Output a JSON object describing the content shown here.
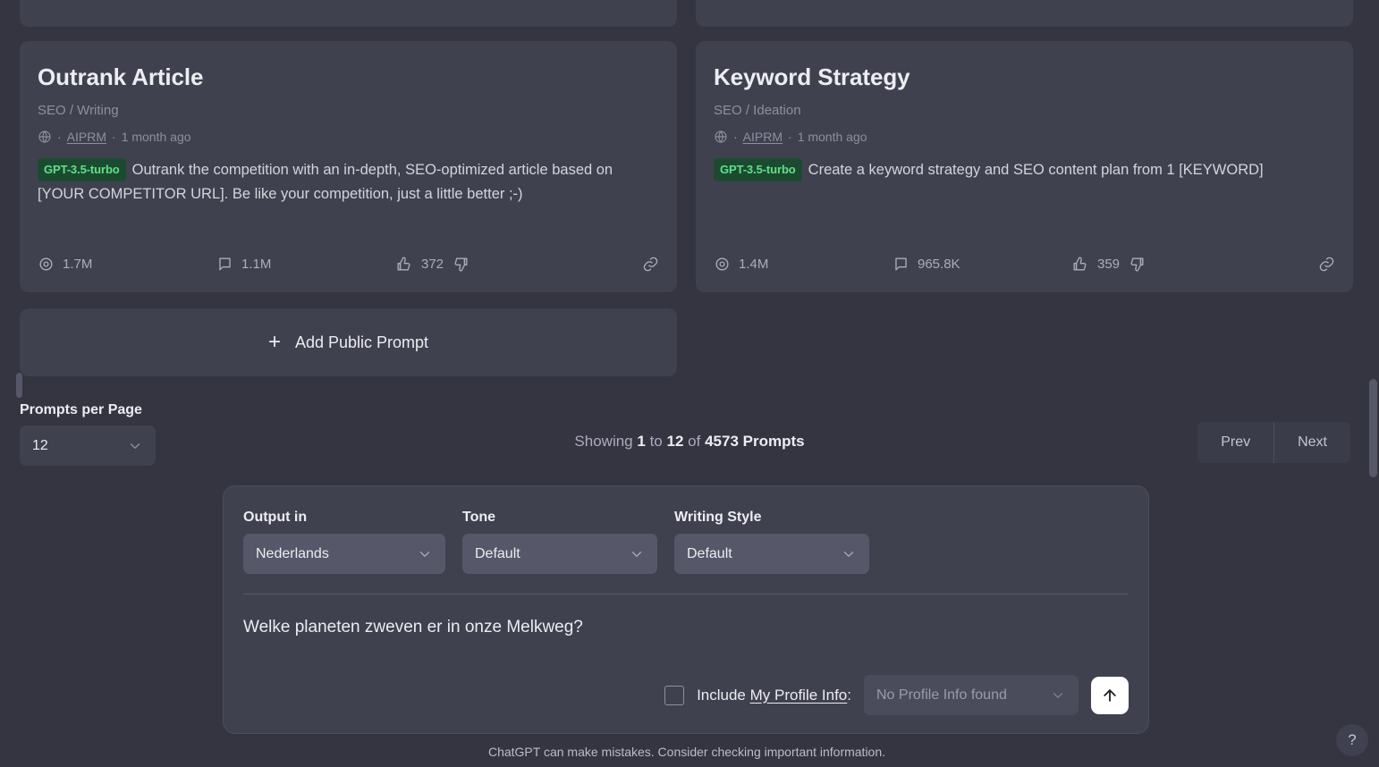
{
  "cards": [
    {
      "title": "Outrank Article",
      "category": "SEO / Writing",
      "author": "AIPRM",
      "age": "1 month ago",
      "separator": "·",
      "model": "GPT-3.5-turbo",
      "description": "Outrank the competition with an in-depth, SEO-optimized article based on [YOUR COMPETITOR URL]. Be like your competition, just a little better ;-)",
      "views": "1.7M",
      "comments": "1.1M",
      "upvotes": "372"
    },
    {
      "title": "Keyword Strategy",
      "category": "SEO / Ideation",
      "author": "AIPRM",
      "age": "1 month ago",
      "separator": "·",
      "model": "GPT-3.5-turbo",
      "description": "Create a keyword strategy and SEO content plan from 1 [KEYWORD]",
      "views": "1.4M",
      "comments": "965.8K",
      "upvotes": "359"
    }
  ],
  "add_prompt": {
    "plus": "+",
    "label": "Add Public Prompt"
  },
  "pagination": {
    "per_page_label": "Prompts per Page",
    "per_page_value": "12",
    "showing_prefix": "Showing",
    "showing_from": "1",
    "showing_to_word": "to",
    "showing_to": "12",
    "showing_of_word": "of",
    "showing_total": "4573 Prompts",
    "prev": "Prev",
    "next": "Next"
  },
  "composer": {
    "output_in_label": "Output in",
    "output_in_value": "Nederlands",
    "tone_label": "Tone",
    "tone_value": "Default",
    "writing_style_label": "Writing Style",
    "writing_style_value": "Default",
    "prompt_text": "Welke planeten zweven er in onze Melkweg?",
    "include_prefix": "Include ",
    "include_link": "My Profile Info",
    "include_suffix": ":",
    "profile_value": "No Profile Info found"
  },
  "footer": {
    "disclaimer": "ChatGPT can make mistakes. Consider checking important information.",
    "help": "?"
  },
  "colors": {
    "page_bg": "#343541",
    "card_bg": "#40414f",
    "control_bg": "#565869",
    "badge_bg": "#1c4a30",
    "badge_text": "#5fe08a",
    "text_primary": "#ececf1",
    "text_muted": "#8e8ea0",
    "accent_send": "#ffffff"
  }
}
